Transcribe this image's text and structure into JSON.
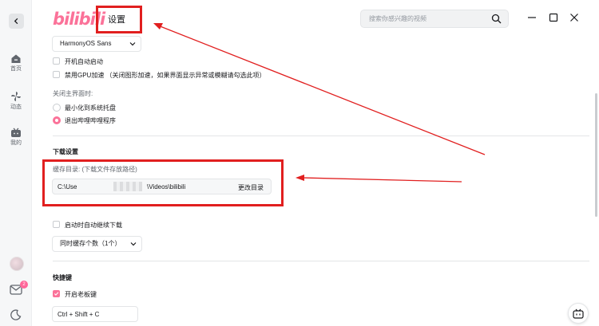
{
  "app": {
    "logo": "bilibili",
    "title": "设置"
  },
  "search": {
    "placeholder": "搜索你感兴趣的视频"
  },
  "rail": {
    "items": [
      {
        "label": "首页",
        "icon": "home-icon"
      },
      {
        "label": "动态",
        "icon": "windmill-icon"
      },
      {
        "label": "我的",
        "icon": "tv-icon"
      }
    ],
    "message_badge": "2"
  },
  "settings": {
    "font_select": "HarmonyOS Sans",
    "autostart_label": "开机自动启动",
    "gpu_label": "禁用GPU加速 （关闭图形加速，如果界面显示异常或模糊请勾选此项）",
    "close_heading": "关闭主界面时:",
    "close_options": [
      {
        "label": "最小化到系统托盘",
        "selected": false
      },
      {
        "label": "退出哔哩哔哩程序",
        "selected": true
      }
    ],
    "download": {
      "heading": "下载设置",
      "cache_label": "缓存目录: (下载文件存放路径)",
      "path_start": "C:\\Use",
      "path_end": "\\Videos\\bilibili",
      "change_button": "更改目录",
      "resume_label": "启动时自动继续下载",
      "concurrent_select": "同时缓存个数（1个）"
    },
    "shortcuts": {
      "heading": "快捷键",
      "boss_key_label": "开启老板键",
      "boss_key_value": "Ctrl + Shift + C"
    }
  },
  "colors": {
    "accent": "#fb7299",
    "annotation": "#e11f1f"
  }
}
